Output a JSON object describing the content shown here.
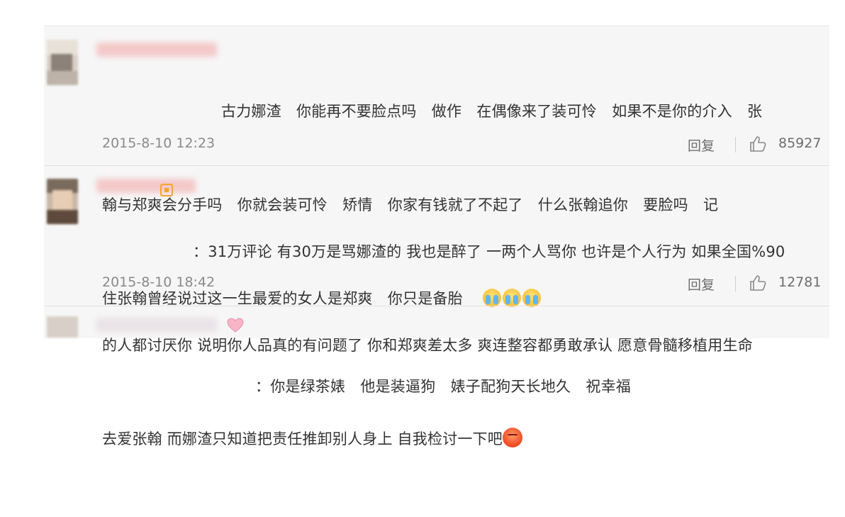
{
  "comments": [
    {
      "text_lines": [
        "古力娜渣　你能再不要脸点吗　做作　在偶像来了装可怜　如果不是你的介入　张",
        "翰与郑爽会分手吗　你就会装可怜　矫情　你家有钱就了不起了　什么张翰追你　要脸吗　记",
        "住张翰曾经说过这一生最爱的女人是郑爽　你只是备胎"
      ],
      "emoji": [
        "crying-face",
        "crying-face",
        "crying-face"
      ],
      "time": "2015-8-10 12:23",
      "reply_label": "回复",
      "likes": "85927"
    },
    {
      "text_lines": [
        "：31万评论 有30万是骂娜渣的 我也是醉了 一两个人骂你 也许是个人行为 如果全国%90",
        "的人都讨厌你 说明你人品真的有问题了 你和郑爽差太多 爽连整容都勇敢承认 愿意骨髓移植用生命",
        "去爱张翰 而娜渣只知道把责任推卸别人身上 自我检讨一下吧"
      ],
      "emoji": [
        "angry-face"
      ],
      "time": "2015-8-10 18:42",
      "reply_label": "回复",
      "likes": "12781"
    },
    {
      "text_lines": [
        "：你是绿茶婊　他是装逼狗　婊子配狗天长地久　祝幸福"
      ]
    }
  ],
  "colors": {
    "text": "#333333",
    "meta": "#8a8a8a",
    "background": "#f6f6f6"
  }
}
